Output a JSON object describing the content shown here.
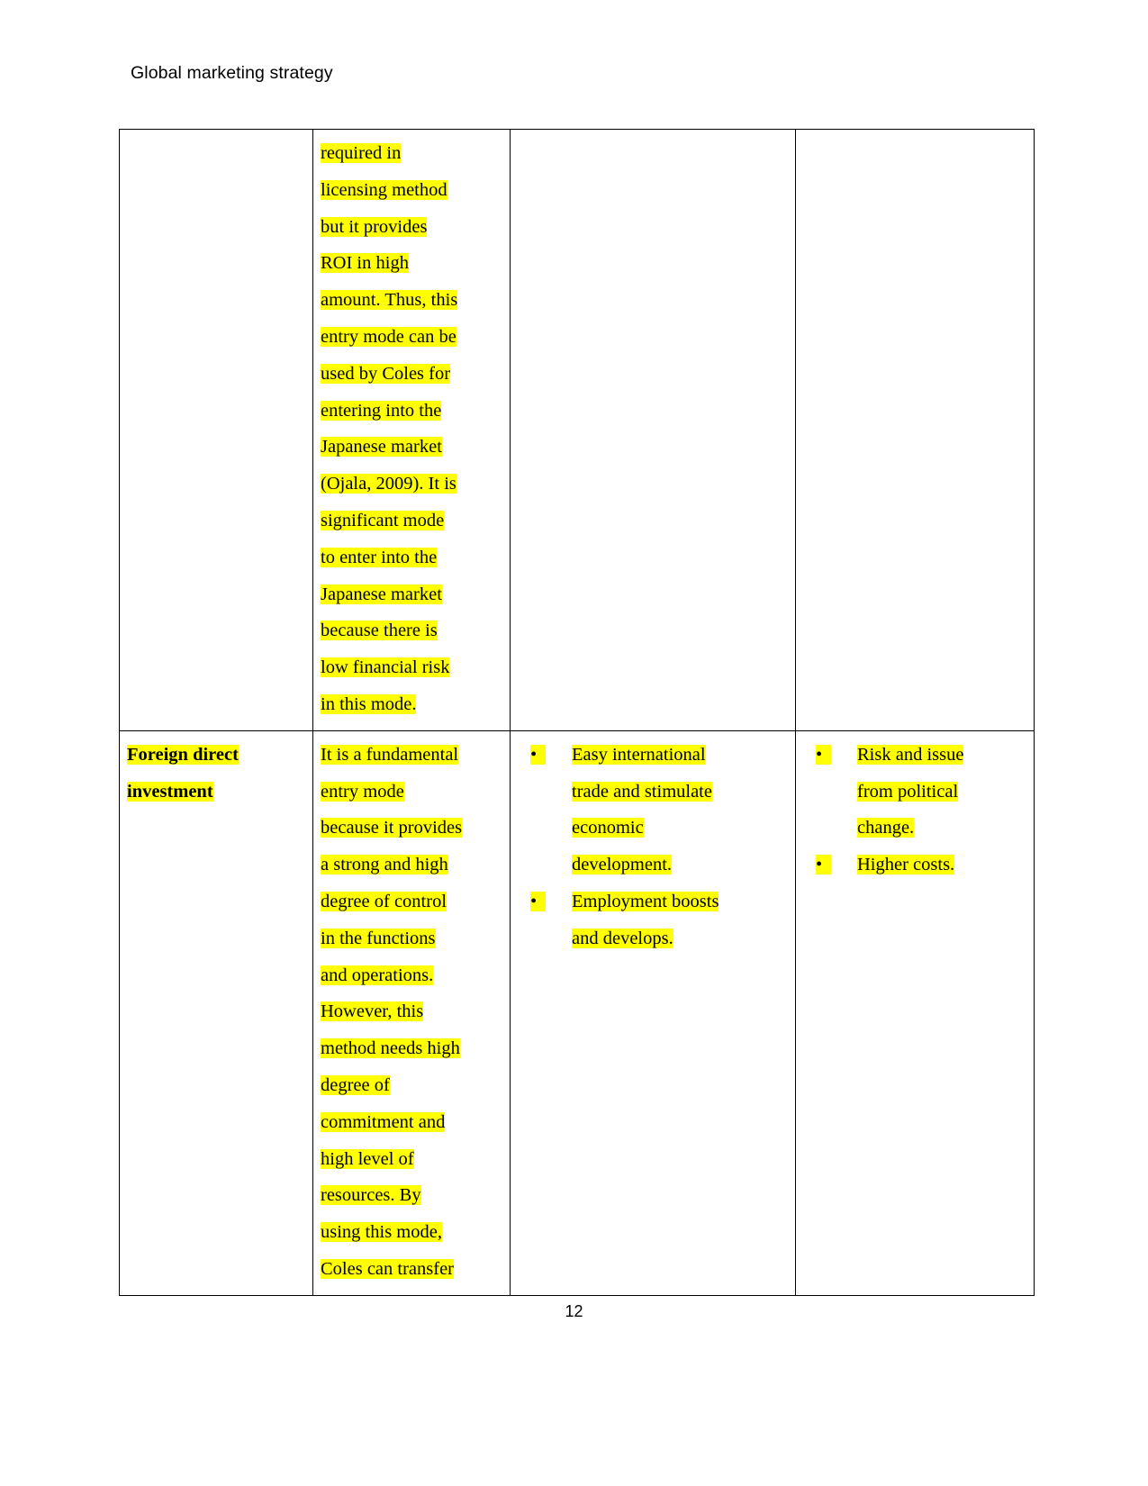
{
  "document": {
    "running_header": "Global marketing strategy",
    "page_number": "12",
    "highlight_color": "#FFFF00"
  },
  "table": {
    "rows": [
      {
        "cells": {
          "mode_name": "",
          "description_lines": [
            "required in",
            "licensing method",
            "but it provides",
            "ROI in high",
            "amount. Thus, this",
            "entry mode can be",
            "used by Coles for",
            "entering into the",
            "Japanese market",
            "(Ojala, 2009). It is",
            "significant mode",
            "to enter into the",
            "Japanese market",
            "because there is",
            "low financial risk",
            "in this mode."
          ],
          "advantages": [],
          "disadvantages": []
        }
      },
      {
        "cells": {
          "mode_name_lines": [
            "Foreign direct",
            "investment"
          ],
          "description_lines": [
            "It is a fundamental",
            "entry mode",
            "because it provides",
            "a strong and high",
            "degree of control",
            "in the functions",
            "and operations.",
            "However, this",
            "method needs high",
            "degree of",
            "commitment and",
            "high level of",
            "resources. By",
            "using this mode,",
            "Coles can transfer"
          ],
          "advantages": [
            {
              "bullet": "•",
              "lines": [
                "Easy international",
                "trade and stimulate",
                "economic",
                "development."
              ]
            },
            {
              "bullet": "•",
              "lines": [
                "Employment boosts",
                "and develops."
              ]
            }
          ],
          "disadvantages": [
            {
              "bullet": "•",
              "lines": [
                "Risk and issue",
                "from political",
                "change."
              ]
            },
            {
              "bullet": "•",
              "lines": [
                "Higher costs."
              ]
            }
          ]
        }
      }
    ]
  }
}
